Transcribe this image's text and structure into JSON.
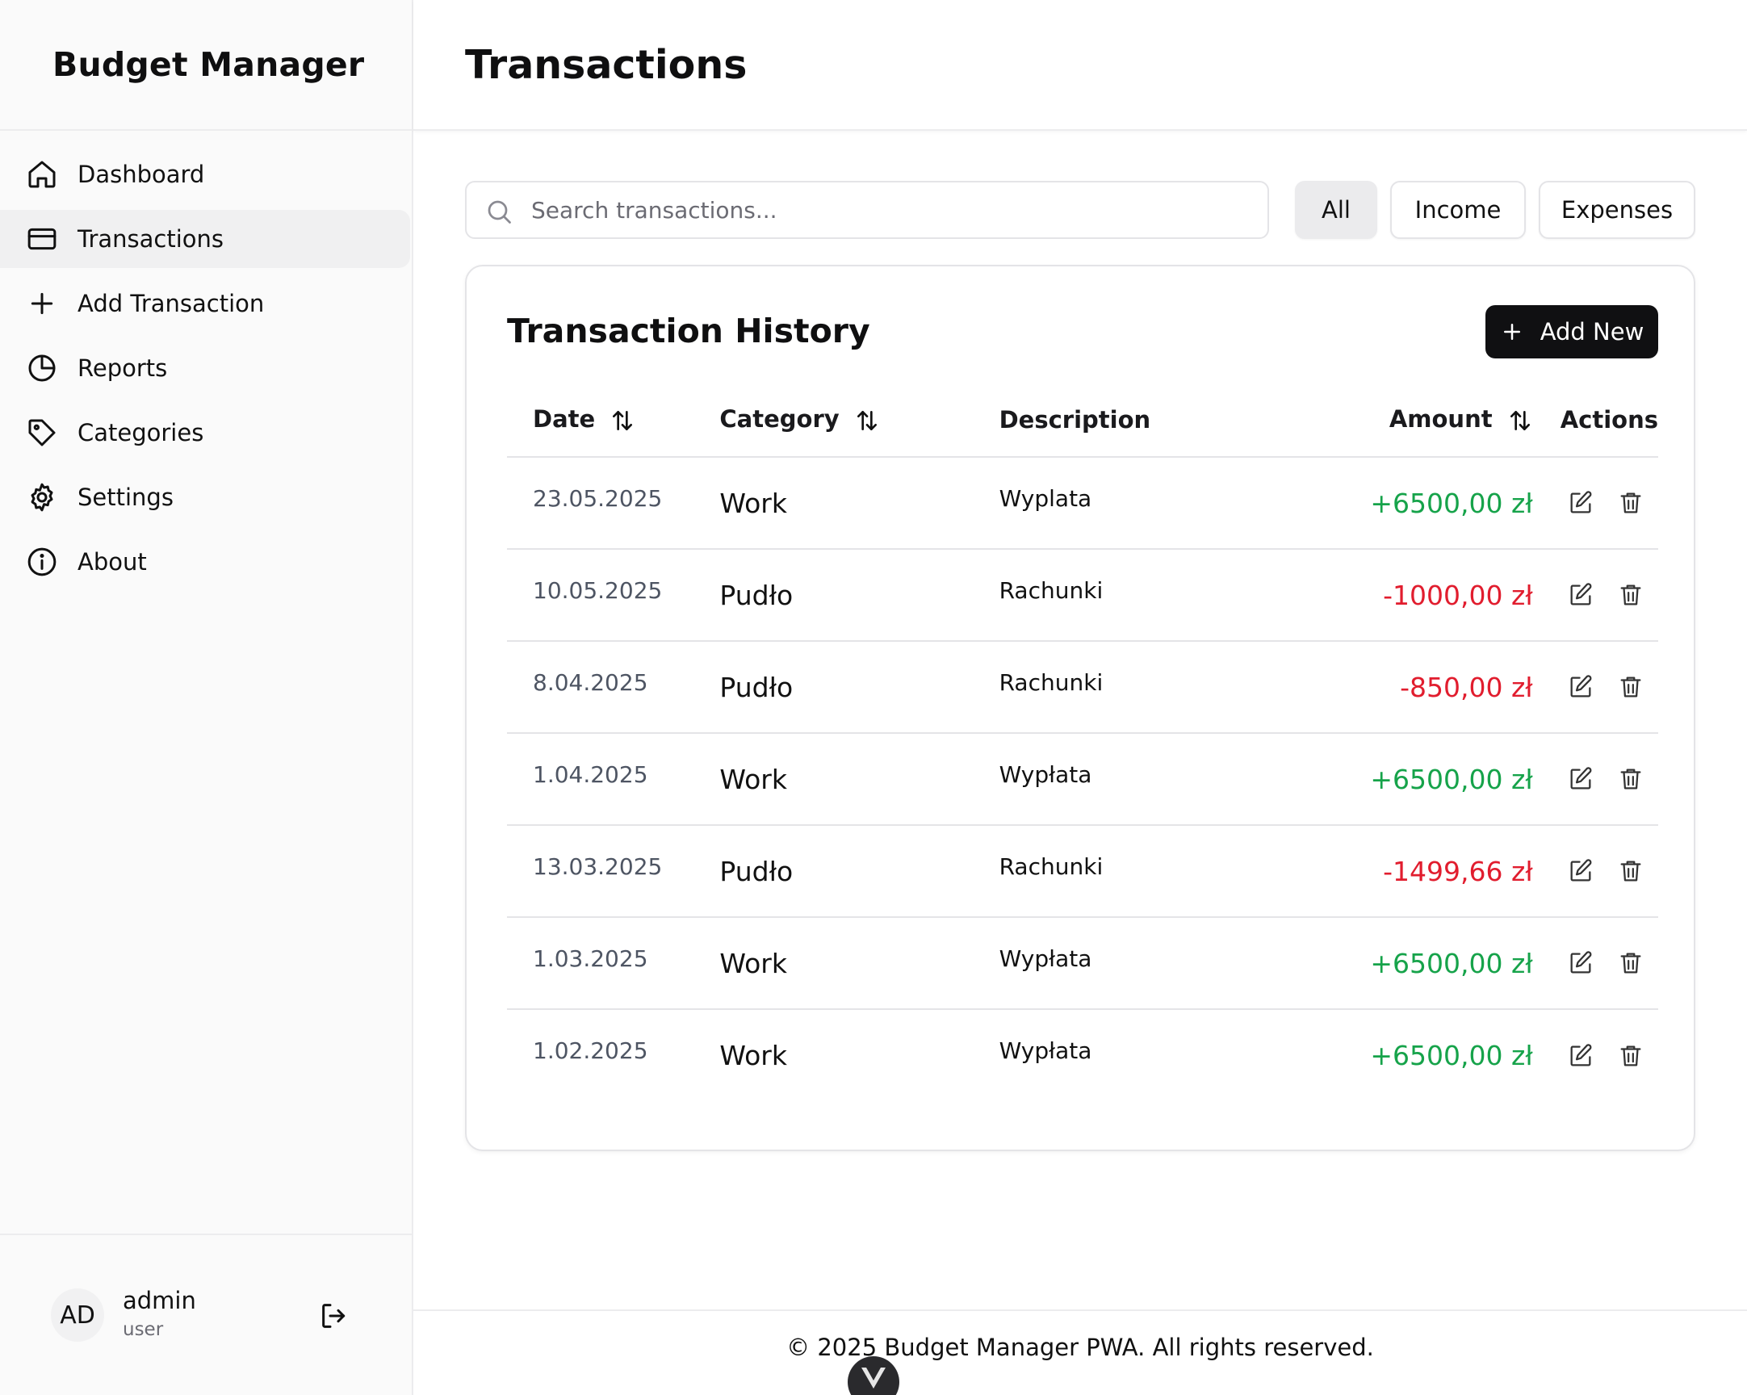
{
  "app": {
    "title": "Budget Manager"
  },
  "sidebar": {
    "items": [
      {
        "label": "Dashboard",
        "icon": "home-icon"
      },
      {
        "label": "Transactions",
        "icon": "credit-card-icon",
        "active": true
      },
      {
        "label": "Add Transaction",
        "icon": "plus-icon"
      },
      {
        "label": "Reports",
        "icon": "pie-chart-icon"
      },
      {
        "label": "Categories",
        "icon": "tag-icon"
      },
      {
        "label": "Settings",
        "icon": "gear-icon"
      },
      {
        "label": "About",
        "icon": "info-icon"
      }
    ]
  },
  "user": {
    "initials": "AD",
    "name": "admin",
    "role": "user"
  },
  "header": {
    "title": "Transactions"
  },
  "search": {
    "placeholder": "Search transactions...",
    "value": ""
  },
  "filters": {
    "all": "All",
    "income": "Income",
    "expenses": "Expenses",
    "selected": "All"
  },
  "card": {
    "title": "Transaction History",
    "add_label": "Add New"
  },
  "table": {
    "headers": {
      "date": "Date",
      "category": "Category",
      "description": "Description",
      "amount": "Amount",
      "actions": "Actions"
    },
    "rows": [
      {
        "date": "23.05.2025",
        "category": "Work",
        "description": "Wyplata",
        "amount": "+6500,00 zł",
        "type": "income"
      },
      {
        "date": "10.05.2025",
        "category": "Pudło",
        "description": "Rachunki",
        "amount": "-1000,00 zł",
        "type": "expense"
      },
      {
        "date": "8.04.2025",
        "category": "Pudło",
        "description": "Rachunki",
        "amount": "-850,00 zł",
        "type": "expense"
      },
      {
        "date": "1.04.2025",
        "category": "Work",
        "description": "Wypłata",
        "amount": "+6500,00 zł",
        "type": "income"
      },
      {
        "date": "13.03.2025",
        "category": "Pudło",
        "description": "Rachunki",
        "amount": "-1499,66 zł",
        "type": "expense"
      },
      {
        "date": "1.03.2025",
        "category": "Work",
        "description": "Wypłata",
        "amount": "+6500,00 zł",
        "type": "income"
      },
      {
        "date": "1.02.2025",
        "category": "Work",
        "description": "Wypłata",
        "amount": "+6500,00 zł",
        "type": "income"
      }
    ]
  },
  "footer": {
    "text": "© 2025 Budget Manager PWA. All rights reserved."
  },
  "colors": {
    "income": "#16a34a",
    "expense": "#e11d2e",
    "accent": "#101012"
  }
}
